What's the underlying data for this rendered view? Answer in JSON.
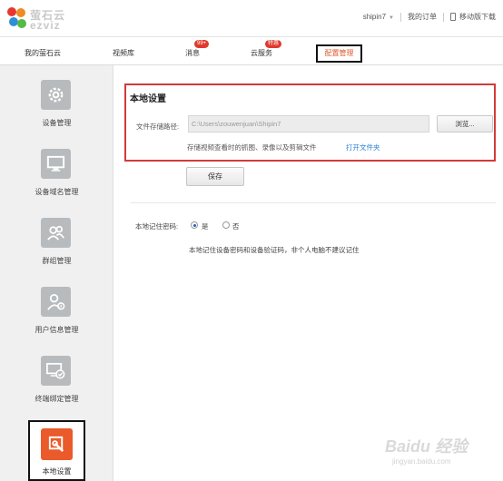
{
  "header": {
    "logo_cn": "萤石云",
    "logo_en": "ezviz",
    "username": "shipin7",
    "my_orders": "我的订单",
    "mobile_download": "移动版下载"
  },
  "nav": {
    "items": [
      {
        "label": "我的萤石云"
      },
      {
        "label": "视频库"
      },
      {
        "label": "消息",
        "badge": "99+"
      },
      {
        "label": "云服务",
        "badge": "特惠"
      },
      {
        "label": "配置管理"
      }
    ]
  },
  "sidebar": {
    "items": [
      {
        "label": "设备管理",
        "icon": "gear-icon"
      },
      {
        "label": "设备域名管理",
        "icon": "monitor-icon"
      },
      {
        "label": "群组管理",
        "icon": "group-icon"
      },
      {
        "label": "用户信息管理",
        "icon": "user-info-icon"
      },
      {
        "label": "终端绑定管理",
        "icon": "terminal-bind-icon"
      },
      {
        "label": "本地设置",
        "icon": "local-settings-icon"
      }
    ]
  },
  "main": {
    "section_title": "本地设置",
    "path_label": "文件存储路径:",
    "path_value": "C:\\Users\\zouwenjuan\\Shipin7",
    "browse_label": "浏览...",
    "path_hint": "存储视频查看时的抓图、录像以及剪辑文件",
    "open_folder": "打开文件夹",
    "save_label": "保存",
    "pwd_label": "本地记住密码:",
    "radio_yes": "是",
    "radio_no": "否",
    "pwd_hint": "本地记住设备密码和设备验证码，非个人电脑不建议记住"
  },
  "watermark": {
    "top": "Baidu 经验",
    "bottom": "jingyan.baidu.com"
  },
  "colors": {
    "accent": "#e25a2b",
    "highlight_border": "#d23a3a",
    "badge": "#e03a2e",
    "link": "#2a7dd3"
  }
}
